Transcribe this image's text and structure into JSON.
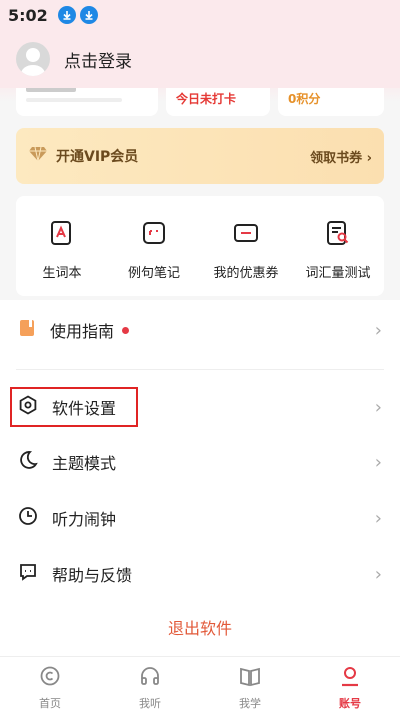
{
  "status_bar": {
    "time": "5:02"
  },
  "header": {
    "login_label": "点击登录"
  },
  "stats": {
    "checkin": "今日未打卡",
    "points": "0积分"
  },
  "vip": {
    "label": "开通VIP会员",
    "action": "领取书券 ›"
  },
  "shortcuts": [
    {
      "label": "生词本",
      "icon": "vocab-book-icon"
    },
    {
      "label": "例句笔记",
      "icon": "sentence-note-icon"
    },
    {
      "label": "我的优惠券",
      "icon": "coupon-icon"
    },
    {
      "label": "词汇量测试",
      "icon": "vocab-test-icon"
    }
  ],
  "menu": [
    {
      "label": "使用指南",
      "icon": "guide-icon",
      "has_dot": true
    },
    {
      "label": "软件设置",
      "icon": "settings-icon"
    },
    {
      "label": "主题模式",
      "icon": "moon-icon"
    },
    {
      "label": "听力闹钟",
      "icon": "clock-icon"
    },
    {
      "label": "帮助与反馈",
      "icon": "feedback-icon"
    }
  ],
  "logout": "退出软件",
  "tabs": [
    {
      "label": "首页",
      "icon": "home-icon"
    },
    {
      "label": "我听",
      "icon": "headphones-icon"
    },
    {
      "label": "我学",
      "icon": "book-icon"
    },
    {
      "label": "账号",
      "icon": "account-icon",
      "active": true
    }
  ],
  "colors": {
    "accent": "#e53945",
    "header_bg": "#fbe9ec",
    "vip_bg": "#fde9c0"
  }
}
